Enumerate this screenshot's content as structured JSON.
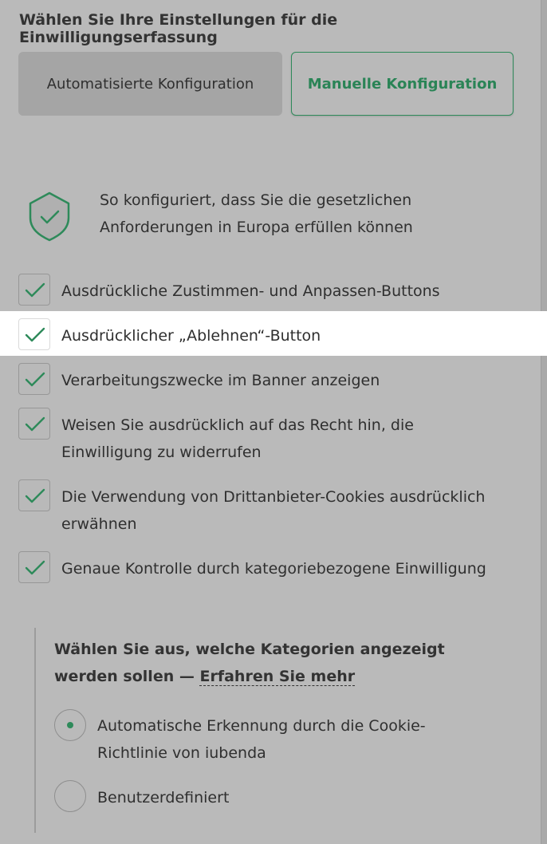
{
  "heading": "Wählen Sie Ihre Einstellungen für die Einwilligungserfassung",
  "tabs": {
    "auto": "Automatisierte Konfiguration",
    "manual": "Manuelle Konfiguration",
    "selected": "manual"
  },
  "info": {
    "icon": "shield-check-icon",
    "text": "So konfiguriert, dass Sie die gesetzlichen Anforderungen in Europa erfüllen können"
  },
  "checklist": [
    {
      "label": "Ausdrückliche Zustimmen- und Anpassen-Buttons",
      "checked": true
    },
    {
      "label": "Ausdrücklicher „Ablehnen“-Button",
      "checked": true,
      "highlighted": true
    },
    {
      "label": "Verarbeitungszwecke im Banner anzeigen",
      "checked": true
    },
    {
      "label": "Weisen Sie ausdrücklich auf das Recht hin, die Einwilligung zu widerrufen",
      "checked": true
    },
    {
      "label": "Die Verwendung von Drittanbieter-Cookies ausdrücklich erwähnen",
      "checked": true
    },
    {
      "label": "Genaue Kontrolle durch kategoriebezogene Einwilligung",
      "checked": true
    }
  ],
  "categories": {
    "title": "Wählen Sie aus, welche Kategorien angezeigt werden sollen —",
    "link": "Erfahren Sie mehr",
    "options": [
      {
        "label": "Automatische Erkennung durch die Cookie-Richtlinie von iubenda",
        "selected": true
      },
      {
        "label": "Benutzerdefiniert",
        "selected": false
      }
    ]
  },
  "colors": {
    "accent": "#2e8a5a",
    "overlay": "#bababa",
    "highlight": "#ffffff"
  }
}
